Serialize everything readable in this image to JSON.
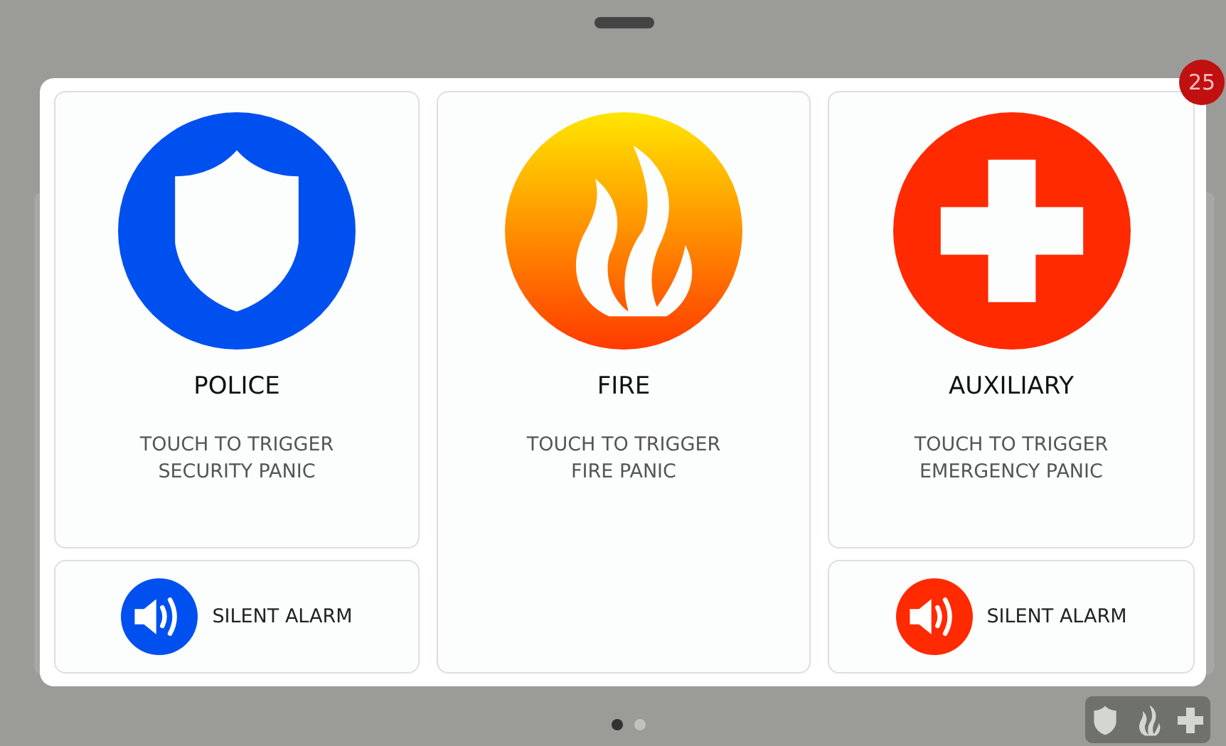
{
  "notification_badge": "25",
  "panels": [
    {
      "kind": "police",
      "title": "POLICE",
      "description": "TOUCH TO TRIGGER\nSECURITY PANIC",
      "color": "#0050ef",
      "silent_alarm": {
        "label": "SILENT ALARM"
      }
    },
    {
      "kind": "fire",
      "title": "FIRE",
      "description": "TOUCH TO TRIGGER\nFIRE PANIC",
      "color": "#ff3a00"
    },
    {
      "kind": "auxiliary",
      "title": "AUXILIARY",
      "description": "TOUCH TO TRIGGER\nEMERGENCY PANIC",
      "color": "#ff2a00",
      "silent_alarm": {
        "label": "SILENT ALARM"
      }
    }
  ],
  "page_dots": [
    {
      "selected": true
    },
    {
      "selected": false
    }
  ],
  "quick_panic_icons": [
    {
      "kind": "police"
    },
    {
      "kind": "fire"
    },
    {
      "kind": "auxiliary"
    }
  ]
}
